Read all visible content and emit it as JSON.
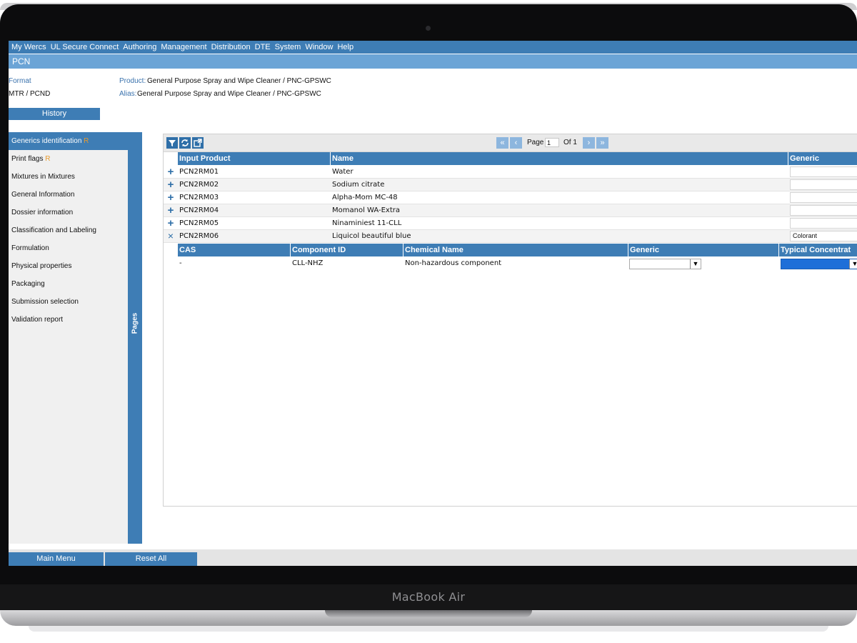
{
  "device": {
    "brand": "MacBook Air"
  },
  "menubar": {
    "items": [
      "My Wercs",
      "UL Secure Connect",
      "Authoring",
      "Management",
      "Distribution",
      "DTE",
      "System",
      "Window",
      "Help"
    ]
  },
  "window": {
    "title": "PCN"
  },
  "info": {
    "format_label": "Format",
    "format_value": "MTR / PCND",
    "product_label": "Product:",
    "product_value": "General Purpose Spray and Wipe Cleaner / PNC-GPSWC",
    "alias_label": "Alias:",
    "alias_value": "General Purpose Spray and Wipe Cleaner / PNC-GPSWC",
    "history_button": "History"
  },
  "sidebar": {
    "pages_label": "Pages",
    "items": [
      {
        "label": "Generics identification",
        "flag": "R"
      },
      {
        "label": "Print flags",
        "flag": "R"
      },
      {
        "label": "Mixtures in Mixtures",
        "flag": ""
      },
      {
        "label": "General Information",
        "flag": ""
      },
      {
        "label": "Dossier information",
        "flag": ""
      },
      {
        "label": "Classification and Labeling",
        "flag": ""
      },
      {
        "label": "Formulation",
        "flag": ""
      },
      {
        "label": "Physical properties",
        "flag": ""
      },
      {
        "label": "Packaging",
        "flag": ""
      },
      {
        "label": "Submission selection",
        "flag": ""
      },
      {
        "label": "Validation report",
        "flag": ""
      }
    ]
  },
  "pager": {
    "page_label": "Page",
    "page_value": "1",
    "of_label": "Of 1"
  },
  "grid": {
    "columns": [
      "Input Product",
      "Name",
      "Generic"
    ],
    "rows": [
      {
        "expander": "+",
        "input_product": "PCN2RM01",
        "name": "Water",
        "generic": ""
      },
      {
        "expander": "+",
        "input_product": "PCN2RM02",
        "name": "Sodium citrate",
        "generic": ""
      },
      {
        "expander": "+",
        "input_product": "PCN2RM03",
        "name": "Alpha-Mom MC-48",
        "generic": ""
      },
      {
        "expander": "+",
        "input_product": "PCN2RM04",
        "name": "Momanol WA-Extra",
        "generic": ""
      },
      {
        "expander": "+",
        "input_product": "PCN2RM05",
        "name": "Ninaminiest 11-CLL",
        "generic": ""
      },
      {
        "expander": "×",
        "input_product": "PCN2RM06",
        "name": "Liquicol beautiful blue",
        "generic": "Colorant"
      }
    ]
  },
  "subgrid": {
    "columns": [
      "CAS",
      "Component ID",
      "Chemical Name",
      "Generic",
      "Typical Concentrat"
    ],
    "rows": [
      {
        "cas": "-",
        "component_id": "CLL-NHZ",
        "chemical_name": "Non-hazardous component",
        "generic": "",
        "typical_concentration": ""
      }
    ]
  },
  "footer": {
    "main_menu": "Main Menu",
    "reset_all": "Reset All"
  },
  "colors": {
    "accent": "#3e7db5",
    "title_bar": "#6ba4d6",
    "flag": "#e89a2d"
  }
}
